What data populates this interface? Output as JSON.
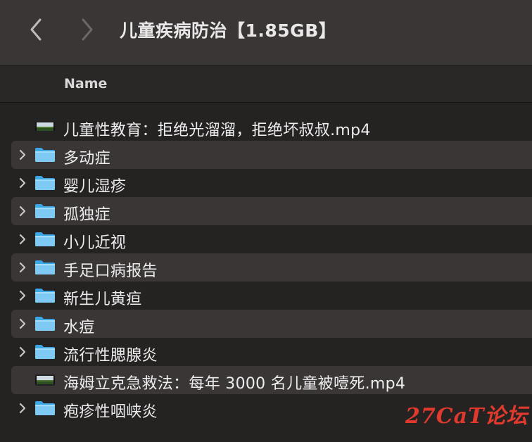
{
  "toolbar": {
    "back_icon": "chevron-left-icon",
    "forward_icon": "chevron-right-icon",
    "title": "儿童疾病防治【1.85GB】"
  },
  "columns": {
    "name": "Name"
  },
  "items": [
    {
      "type": "video",
      "label": "儿童性教育：拒绝光溜溜，拒绝坏叔叔.mp4",
      "expandable": false
    },
    {
      "type": "folder",
      "label": "多动症",
      "expandable": true
    },
    {
      "type": "folder",
      "label": "婴儿湿疹",
      "expandable": true
    },
    {
      "type": "folder",
      "label": "孤独症",
      "expandable": true
    },
    {
      "type": "folder",
      "label": "小儿近视",
      "expandable": true
    },
    {
      "type": "folder",
      "label": "手足口病报告",
      "expandable": true
    },
    {
      "type": "folder",
      "label": "新生儿黄疸",
      "expandable": true
    },
    {
      "type": "folder",
      "label": "水痘",
      "expandable": true
    },
    {
      "type": "folder",
      "label": "流行性腮腺炎",
      "expandable": true
    },
    {
      "type": "video",
      "label": "海姆立克急救法：每年 3000 名儿童被噎死.mp4",
      "expandable": false
    },
    {
      "type": "folder",
      "label": "疱疹性咽峡炎",
      "expandable": true
    }
  ],
  "watermark": {
    "text": "27CaT论坛"
  },
  "colors": {
    "folder_blue": "#3da7e6",
    "folder_blue_light": "#7fcaf3",
    "row_stripe": "#3a3636",
    "watermark": "#e03a2e"
  }
}
